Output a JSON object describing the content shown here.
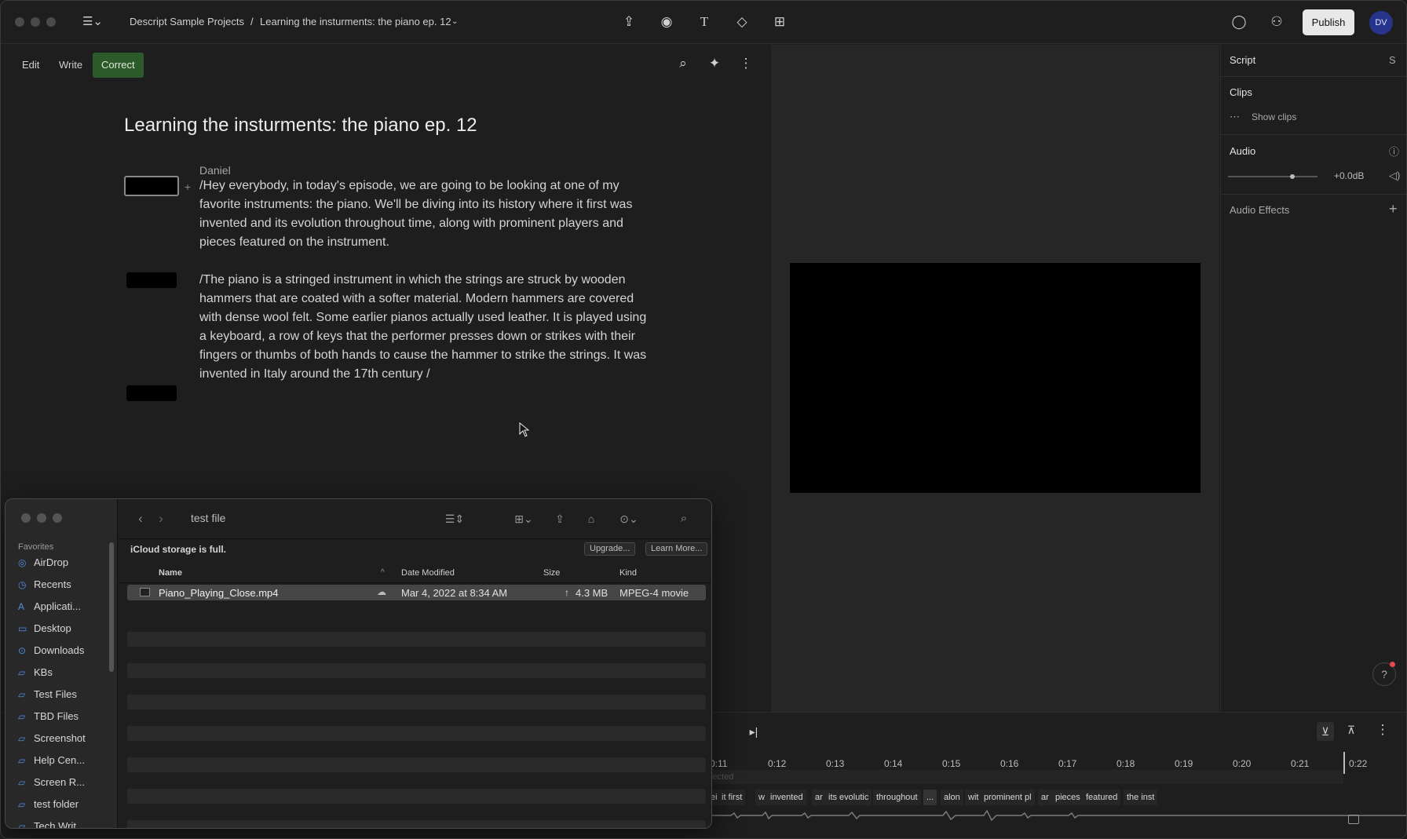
{
  "topbar": {
    "breadcrumb_project": "Descript Sample Projects",
    "breadcrumb_sep": "/",
    "breadcrumb_doc": "Learning the insturments: the piano ep. 12",
    "publish_label": "Publish",
    "avatar_initials": "DV"
  },
  "editor": {
    "modes": [
      "Edit",
      "Write",
      "Correct"
    ],
    "active_mode": "Correct",
    "title": "Learning the insturments: the piano ep. 12",
    "speaker": "Daniel",
    "paragraph1": "/Hey everybody, in today's episode, we are going to be looking at one of my favorite instruments: the piano. We'll be diving into its history where it first was invented and its evolution throughout time, along with prominent players and pieces featured on the instrument.",
    "paragraph2": "/The piano is a stringed instrument in which the strings are struck by wooden hammers that are coated with a softer material. Modern hammers are covered with dense wool felt. Some earlier pianos actually used leather. It is played using a keyboard, a row of keys that the performer presses down or strikes with their fingers or thumbs of both hands to cause the hammer to strike the strings. It was invented in Italy around the 17th century /"
  },
  "rpanel": {
    "script_label": "Script",
    "script_shortcut": "S",
    "clips_label": "Clips",
    "show_clips": "Show clips",
    "audio_label": "Audio",
    "volume": "+0.0dB",
    "audio_effects": "Audio Effects"
  },
  "timeline": {
    "ticks": [
      "0:11",
      "0:12",
      "0:13",
      "0:14",
      "0:15",
      "0:16",
      "0:17",
      "0:18",
      "0:19",
      "0:20",
      "0:21",
      "0:22"
    ],
    "selected_hint": "lected",
    "words": [
      "ei",
      "it first",
      "w",
      "invented",
      "ar",
      "its evolutic",
      "throughout",
      "...",
      "alon",
      "wit",
      "prominent pl",
      "ar",
      "pieces",
      "featured",
      "the inst"
    ]
  },
  "finder": {
    "folder_name": "test file",
    "favorites_header": "Favorites",
    "sidebar": [
      {
        "label": "AirDrop",
        "icon": "airdrop-icon",
        "glyph": "◎"
      },
      {
        "label": "Recents",
        "icon": "clock-icon",
        "glyph": "◷"
      },
      {
        "label": "Applicati...",
        "icon": "applications-icon",
        "glyph": "A"
      },
      {
        "label": "Desktop",
        "icon": "desktop-icon",
        "glyph": "▭"
      },
      {
        "label": "Downloads",
        "icon": "downloads-icon",
        "glyph": "⊙"
      },
      {
        "label": "KBs",
        "icon": "folder-icon",
        "glyph": "▱"
      },
      {
        "label": "Test Files",
        "icon": "folder-icon",
        "glyph": "▱"
      },
      {
        "label": "TBD Files",
        "icon": "folder-icon",
        "glyph": "▱"
      },
      {
        "label": "Screenshot",
        "icon": "folder-icon",
        "glyph": "▱"
      },
      {
        "label": "Help Cen...",
        "icon": "folder-icon",
        "glyph": "▱"
      },
      {
        "label": "Screen R...",
        "icon": "folder-icon",
        "glyph": "▱"
      },
      {
        "label": "test folder",
        "icon": "folder-icon",
        "glyph": "▱"
      },
      {
        "label": "Tech Writ...",
        "icon": "folder-icon",
        "glyph": "▱"
      }
    ],
    "icloud_msg": "iCloud storage is full.",
    "upgrade_label": "Upgrade...",
    "learn_more_label": "Learn More...",
    "columns": {
      "name": "Name",
      "date": "Date Modified",
      "size": "Size",
      "kind": "Kind"
    },
    "file": {
      "name": "Piano_Playing_Close.mp4",
      "date": "Mar 4, 2022 at 8:34 AM",
      "size": "4.3 MB",
      "kind": "MPEG-4 movie"
    }
  }
}
